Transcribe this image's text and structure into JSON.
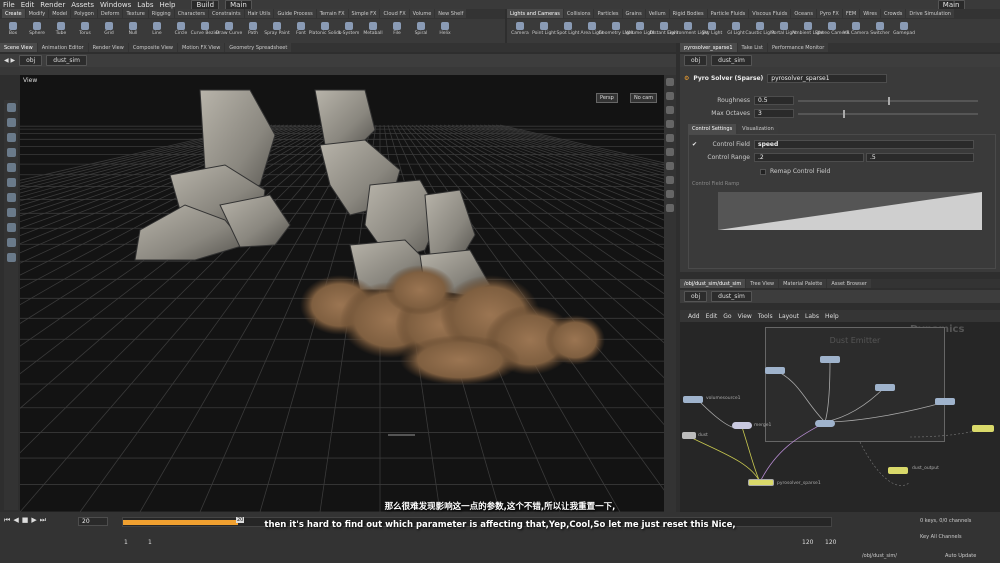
{
  "menubar": {
    "items": [
      "File",
      "Edit",
      "Render",
      "Assets",
      "Windows",
      "Labs",
      "Help"
    ],
    "build": "Build",
    "main_desk": "Main",
    "right_desk": "Main"
  },
  "shelf_left": {
    "tabs": [
      "Create",
      "Modify",
      "Model",
      "Polygon",
      "Deform",
      "Texture",
      "Rigging",
      "Characters",
      "Constraints",
      "Hair Utils",
      "Guide Process",
      "Terrain FX",
      "Simple FX",
      "Cloud FX",
      "Volume",
      "New Shelf"
    ],
    "tools": [
      "Box",
      "Sphere",
      "Tube",
      "Torus",
      "Grid",
      "Null",
      "Line",
      "Circle",
      "Curve Bezier",
      "Draw Curve",
      "Path",
      "Spray Paint",
      "Font",
      "Platonic Solids",
      "L-System",
      "Metaball",
      "File",
      "Spiral",
      "Helix"
    ]
  },
  "shelf_right": {
    "tabs": [
      "Lights and Cameras",
      "Collisions",
      "Particles",
      "Grains",
      "Vellum",
      "Rigid Bodies",
      "Particle Fluids",
      "Viscous Fluids",
      "Oceans",
      "Pyro FX",
      "FEM",
      "Wires",
      "Crowds",
      "Drive Simulation"
    ],
    "tools": [
      "Camera",
      "Point Light",
      "Spot Light",
      "Area Light",
      "Geometry Light",
      "Volume Light",
      "Distant Light",
      "Environment Light",
      "Sky Light",
      "GI Light",
      "Caustic Light",
      "Portal Light",
      "Ambient Light",
      "Stereo Camera",
      "VR Camera",
      "Switcher",
      "Gamepad"
    ]
  },
  "left_pane": {
    "tabs": [
      "Scene View",
      "Animation Editor",
      "Render View",
      "Composite View",
      "Motion FX View",
      "Geometry Spreadsheet"
    ],
    "path": [
      "obj",
      "dust_sim"
    ],
    "view_label": "View",
    "persp": "Persp",
    "cam": "No cam"
  },
  "param_pane": {
    "tabs": [
      "pyrosolver_sparse1",
      "Take List",
      "Performance Monitor"
    ],
    "path": [
      "obj",
      "dust_sim"
    ],
    "node_type": "Pyro Solver (Sparse)",
    "node_name": "pyrosolver_sparse1",
    "roughness_label": "Roughness",
    "roughness": "0.5",
    "roughness_frac": 0.5,
    "octaves_label": "Max Octaves",
    "octaves": "3",
    "octaves_frac": 0.25,
    "subtabs": [
      "Control Settings",
      "Visualization"
    ],
    "control_field_label": "Control Field",
    "control_field": "speed",
    "control_range_label": "Control Range",
    "control_range_min": ".2",
    "control_range_max": ".5",
    "remap_label": "Remap Control Field",
    "ramp_label": "Control Field Ramp"
  },
  "network_pane": {
    "tabs": [
      "/obj/dust_sim/dust_sim",
      "Tree View",
      "Material Palette",
      "Asset Browser"
    ],
    "path": [
      "obj",
      "dust_sim"
    ],
    "menu": [
      "Add",
      "Edit",
      "Go",
      "View",
      "Tools",
      "Layout",
      "Labs",
      "Help"
    ],
    "context": "Dynamics",
    "box_label": "Dust Emitter",
    "nodes": {
      "volumesource": "volumesource1",
      "dust": "dust",
      "merge": "merge1",
      "pyrosolver": "pyrosolver_sparse1",
      "output": "dust_output"
    }
  },
  "timeline": {
    "frame": "20",
    "start": "1",
    "start2": "1",
    "end": "120",
    "end2": "120",
    "keys": "0 keys, 0/0 channels",
    "key_all": "Key All Channels",
    "path": "/obj/dust_sim/",
    "auto_update": "Auto Update",
    "frame_marker": "20"
  },
  "subtitle": {
    "zh": "那么很难发现影响这一点的参数,这个不错,所以让我重置一下,",
    "en": "then it's hard to find out which parameter is affecting that,Yep,Cool,So let me just reset this Nice,"
  },
  "colors": {
    "accent": "#f0a030",
    "node": "#9fb3cc",
    "dust": "#8a6a48"
  }
}
